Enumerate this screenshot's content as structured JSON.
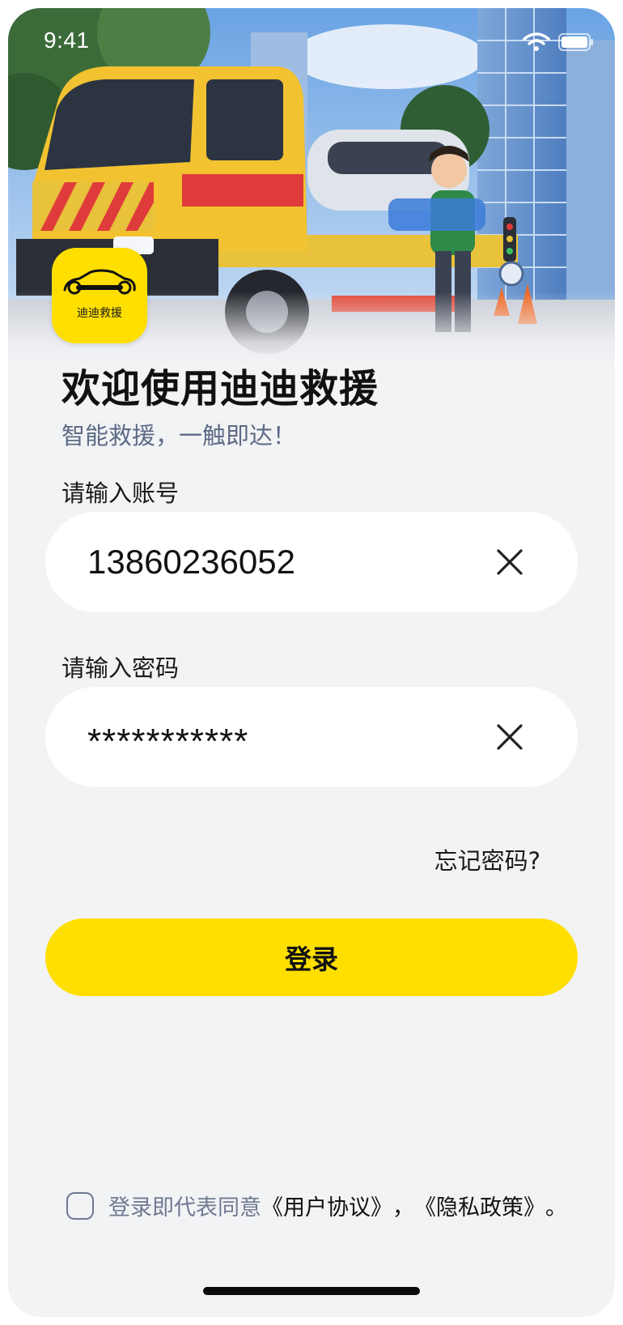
{
  "status_bar": {
    "time": "9:41"
  },
  "logo": {
    "text": "迪迪救援"
  },
  "header": {
    "title": "欢迎使用迪迪救援",
    "subtitle": "智能救援，一触即达！"
  },
  "account": {
    "label": "请输入账号",
    "value": "13860236052"
  },
  "password": {
    "label": "请输入密码",
    "value": "***********"
  },
  "forgot_password": "忘记密码?",
  "login_button": "登录",
  "agreement": {
    "prefix": "登录即代表同意",
    "user_agreement": "《用户协议》",
    "separator": "，",
    "privacy_policy": "《隐私政策》",
    "suffix": "。",
    "checked": false
  },
  "colors": {
    "accent": "#ffdf00",
    "background": "#f2f3f5",
    "muted_text": "#6f7a91"
  },
  "icons": [
    "wifi-icon",
    "battery-icon",
    "car-wrench-icon",
    "clear-icon",
    "checkbox-icon"
  ]
}
